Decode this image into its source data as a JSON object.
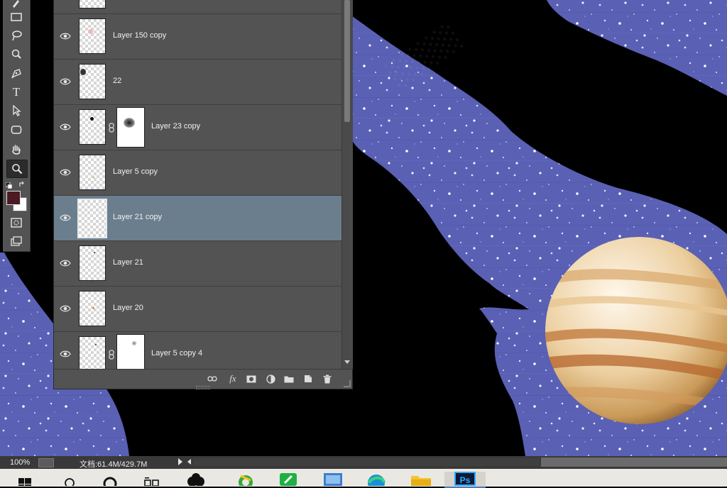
{
  "layers_panel": {
    "layers": [
      {
        "name": "Layer 150 copy",
        "visible": true,
        "selected": false,
        "has_mask": false
      },
      {
        "name": "22",
        "visible": true,
        "selected": false,
        "has_mask": false
      },
      {
        "name": "Layer 23 copy",
        "visible": true,
        "selected": false,
        "has_mask": true
      },
      {
        "name": "Layer 5 copy",
        "visible": true,
        "selected": false,
        "has_mask": false
      },
      {
        "name": "Layer 21 copy",
        "visible": true,
        "selected": true,
        "has_mask": false
      },
      {
        "name": "Layer 21",
        "visible": true,
        "selected": false,
        "has_mask": false
      },
      {
        "name": "Layer 20",
        "visible": true,
        "selected": false,
        "has_mask": false
      },
      {
        "name": "Layer 5 copy 4",
        "visible": true,
        "selected": false,
        "has_mask": true
      }
    ],
    "footer_icons": [
      "link-icon",
      "fx-icon",
      "add-mask-icon",
      "adjustment-icon",
      "group-folder-icon",
      "new-layer-icon",
      "trash-icon"
    ],
    "fx_label": "fx"
  },
  "toolbox": {
    "tools": [
      "brush-icon",
      "rectangle-select-icon",
      "lasso-icon",
      "quick-select-icon",
      "pen-icon",
      "type-icon",
      "path-select-icon",
      "rounded-rect-icon",
      "hand-icon",
      "zoom-icon"
    ],
    "type_glyph": "T",
    "active_tool": "zoom-icon",
    "foreground_color": "#4b1a22",
    "background_color": "#ffffff"
  },
  "status": {
    "zoom": "100%",
    "doc_info": "文档:61.4M/429.7M"
  },
  "taskbar": {
    "apps": [
      "windows-start-icon",
      "search-icon",
      "cortana-icon",
      "task-view-icon",
      "app-icon",
      "browser-360-icon",
      "green-app-icon",
      "blue-app-icon",
      "edge-icon",
      "file-explorer-icon",
      "photoshop-icon"
    ],
    "active_app": "photoshop-icon",
    "photoshop_label": "Ps"
  },
  "colors": {
    "panel_bg": "#535353",
    "selected_row": "#6b7e8e",
    "space_blue": "#5a60b4",
    "canvas_black": "#000000",
    "planet_tan": "#e4c08a"
  }
}
